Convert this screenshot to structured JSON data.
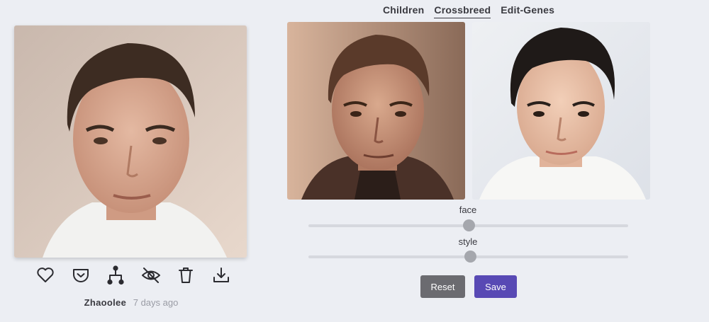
{
  "tabs": [
    {
      "label": "Children",
      "active": false
    },
    {
      "label": "Crossbreed",
      "active": true
    },
    {
      "label": "Edit-Genes",
      "active": false
    }
  ],
  "main_image": {
    "alt": "Generated child portrait"
  },
  "actions": [
    {
      "name": "like",
      "icon": "heart-icon"
    },
    {
      "name": "save-to-pocket",
      "icon": "pocket-icon"
    },
    {
      "name": "family-tree",
      "icon": "lineage-icon"
    },
    {
      "name": "hide",
      "icon": "eye-off-icon"
    },
    {
      "name": "delete",
      "icon": "trash-icon"
    },
    {
      "name": "download",
      "icon": "download-icon"
    }
  ],
  "meta": {
    "author": "Zhaoolee",
    "time": "7 days ago"
  },
  "sliders": {
    "face": {
      "label": "face",
      "value": 0.5
    },
    "style": {
      "label": "style",
      "value": 0.505
    }
  },
  "buttons": {
    "reset": "Reset",
    "save": "Save"
  },
  "colors": {
    "background": "#eceef3",
    "save": "#5849b4",
    "reset": "#6b6b70",
    "thumb": "#a5a7ad"
  }
}
